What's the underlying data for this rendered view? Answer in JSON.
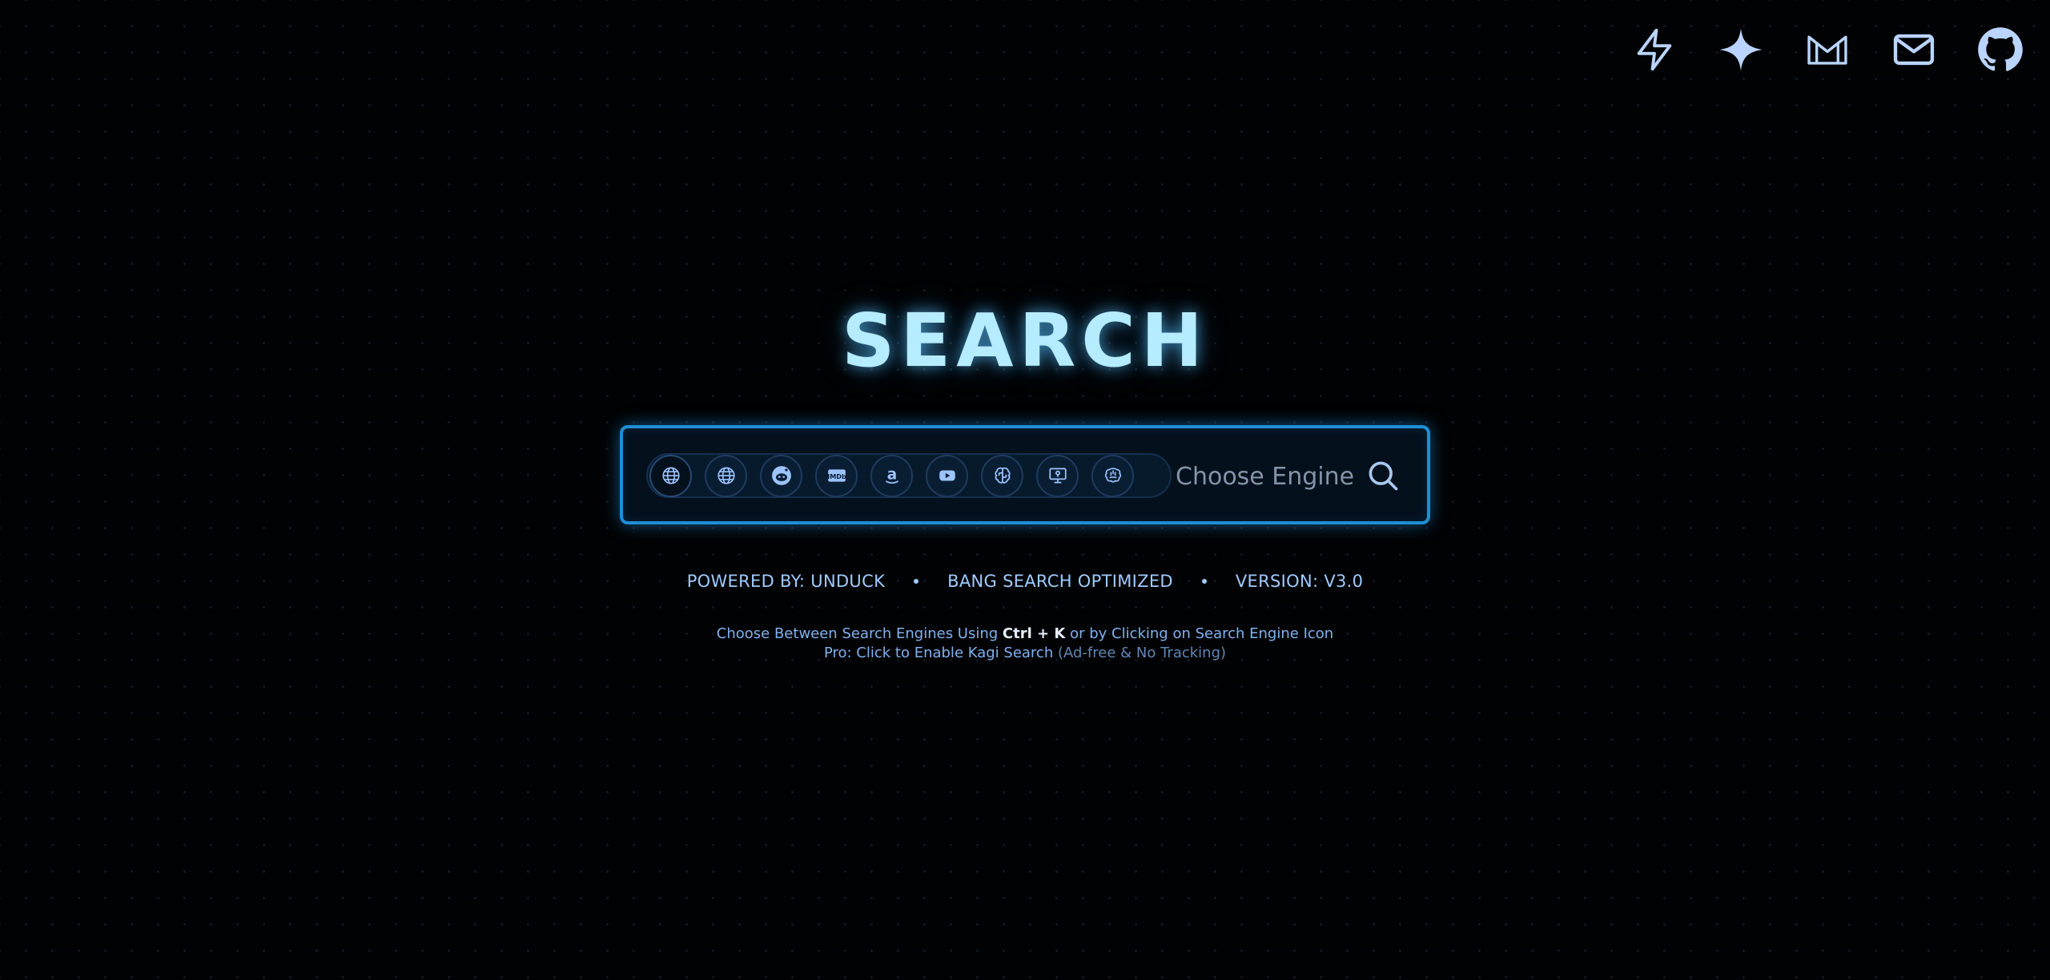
{
  "top_icons": [
    {
      "name": "lightning-icon"
    },
    {
      "name": "sparkle-icon"
    },
    {
      "name": "gmail-icon"
    },
    {
      "name": "mail-icon"
    },
    {
      "name": "github-icon"
    }
  ],
  "title": "SEARCH",
  "search": {
    "placeholder": "Choose Engine",
    "engines": [
      {
        "icon": "globe-icon"
      },
      {
        "icon": "globe-icon"
      },
      {
        "icon": "reddit-icon"
      },
      {
        "icon": "imdb-icon",
        "text": "IMDb"
      },
      {
        "icon": "amazon-icon",
        "text": "a"
      },
      {
        "icon": "youtube-icon"
      },
      {
        "icon": "brain-circuit-icon"
      },
      {
        "icon": "monitor-icon"
      },
      {
        "icon": "brain-icon"
      }
    ]
  },
  "info": {
    "powered_by": "POWERED BY: UNDUCK",
    "bang": "BANG SEARCH OPTIMIZED",
    "version": "VERSION: V3.0"
  },
  "hints": {
    "line1_pre": "Choose Between Search Engines Using ",
    "line1_shortcut": "Ctrl + K",
    "line1_post": " or by Clicking on Search Engine Icon",
    "line2_main": "Pro: Click to Enable Kagi Search",
    "line2_muted": " (Ad-free & No Tracking)"
  },
  "colors": {
    "accent": "#1e8ed6",
    "title": "#b6ecff",
    "text": "#9fcbff",
    "background": "#010203"
  }
}
